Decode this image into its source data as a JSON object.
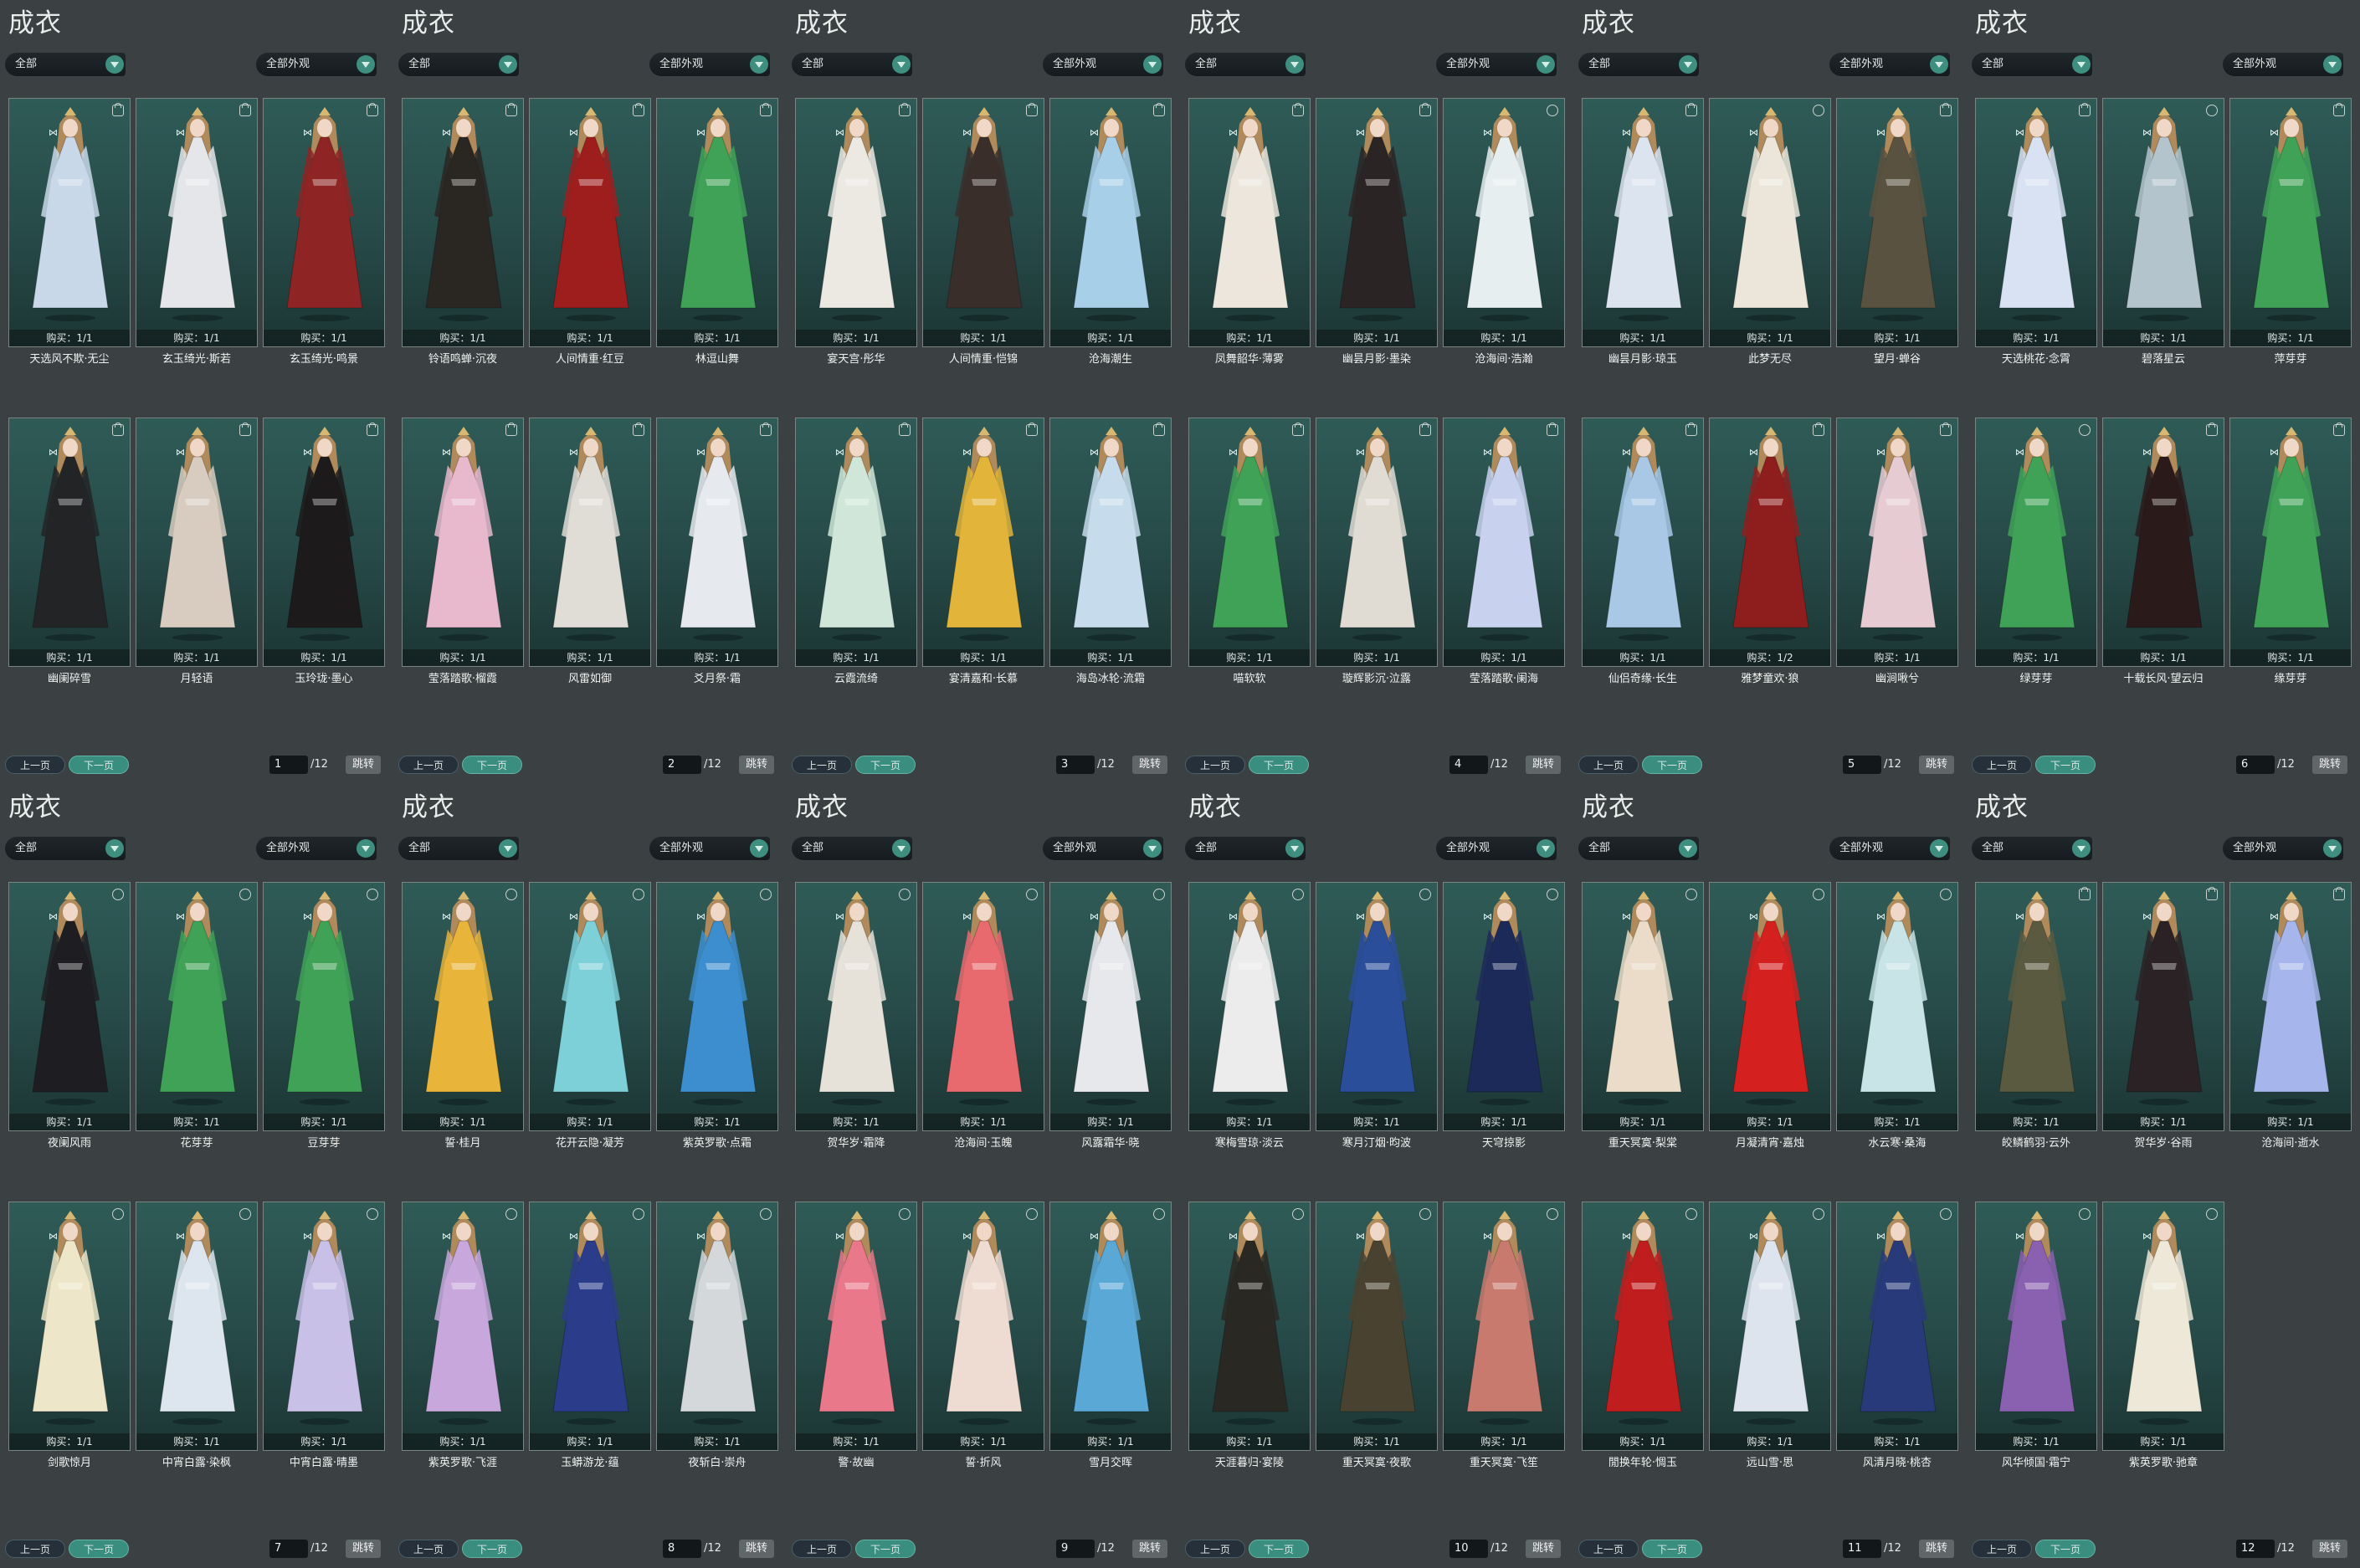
{
  "common": {
    "title": "成衣",
    "filter_left": "全部",
    "filter_right": "全部外观",
    "prev_label": "上一页",
    "next_label": "下一页",
    "total": "/12",
    "jump_label": "跳转"
  },
  "panels": [
    {
      "page": "1",
      "items": [
        {
          "name": "天选风不欺·无尘",
          "buy": "购买：1/1",
          "color": "#c8d8e8",
          "badge": "lock"
        },
        {
          "name": "玄玉绮光·斯若",
          "buy": "购买：1/1",
          "color": "#e4e6ea",
          "badge": "lock"
        },
        {
          "name": "玄玉绮光·鸣景",
          "buy": "购买：1/1",
          "color": "#8e2424",
          "badge": "lock"
        },
        {
          "name": "幽阑碎雪",
          "buy": "购买：1/1",
          "color": "#222426",
          "badge": "lock"
        },
        {
          "name": "月轻语",
          "buy": "购买：1/1",
          "color": "#d8ccc0",
          "badge": "lock"
        },
        {
          "name": "玉玲珑·墨心",
          "buy": "购买：1/1",
          "color": "#1c1a1a",
          "badge": "lock"
        }
      ]
    },
    {
      "page": "2",
      "items": [
        {
          "name": "铃语鸣蝉·沉夜",
          "buy": "购买：1/1",
          "color": "#2a2622",
          "badge": "lock"
        },
        {
          "name": "人间情重·红豆",
          "buy": "购买：1/1",
          "color": "#9e1e1e",
          "badge": "lock"
        },
        {
          "name": "林逗山舞",
          "buy": "购买：1/1",
          "color": "#3fa257",
          "badge": "lock"
        },
        {
          "name": "莹落踏歌·榴霞",
          "buy": "购买：1/1",
          "color": "#e8b8cc",
          "badge": "lock"
        },
        {
          "name": "风雷如御",
          "buy": "购买：1/1",
          "color": "#e0ddd6",
          "badge": "lock"
        },
        {
          "name": "爻月祭·霜",
          "buy": "购买：1/1",
          "color": "#e6eaee",
          "badge": "lock"
        }
      ]
    },
    {
      "page": "3",
      "items": [
        {
          "name": "宴天宫·彤华",
          "buy": "购买：1/1",
          "color": "#ece9e2",
          "badge": "lock"
        },
        {
          "name": "人间情重·恺锦",
          "buy": "购买：1/1",
          "color": "#3a2e2a",
          "badge": "lock"
        },
        {
          "name": "沧海潮生",
          "buy": "购买：1/1",
          "color": "#a8cfe8",
          "badge": "lock"
        },
        {
          "name": "云霞流绮",
          "buy": "购买：1/1",
          "color": "#cfe6d8",
          "badge": "lock"
        },
        {
          "name": "宴清嘉和·长慕",
          "buy": "购买：1/1",
          "color": "#e2b43a",
          "badge": "lock"
        },
        {
          "name": "海岛冰轮·流霜",
          "buy": "购买：1/1",
          "color": "#c6dcec",
          "badge": "lock"
        }
      ]
    },
    {
      "page": "4",
      "items": [
        {
          "name": "凤舞韶华·薄雾",
          "buy": "购买：1/1",
          "color": "#ece6dc",
          "badge": "lock"
        },
        {
          "name": "幽昙月影·墨染",
          "buy": "购买：1/1",
          "color": "#2a2424",
          "badge": "lock"
        },
        {
          "name": "沧海间·浩瀚",
          "buy": "购买：1/1",
          "color": "#e6eef0",
          "badge": "cycle"
        },
        {
          "name": "喵软软",
          "buy": "购买：1/1",
          "color": "#3fa257",
          "badge": "lock"
        },
        {
          "name": "璇辉影沉·泣露",
          "buy": "购买：1/1",
          "color": "#e0dcd4",
          "badge": "lock"
        },
        {
          "name": "莹落踏歌·阑海",
          "buy": "购买：1/1",
          "color": "#c8d2ee",
          "badge": "lock"
        }
      ]
    },
    {
      "page": "5",
      "items": [
        {
          "name": "幽昙月影·琼玉",
          "buy": "购买：1/1",
          "color": "#dce4f0",
          "badge": "lock"
        },
        {
          "name": "此梦无尽",
          "buy": "购买：1/1",
          "color": "#ece6da",
          "badge": "cycle"
        },
        {
          "name": "望月·蝉谷",
          "buy": "购买：1/1",
          "color": "#5a5240",
          "badge": "lock"
        },
        {
          "name": "仙侣奇缘·长生",
          "buy": "购买：1/1",
          "color": "#a8c8e6",
          "badge": "lock"
        },
        {
          "name": "雅梦童欢·狼",
          "buy": "购买：1/2",
          "color": "#8e1e1e",
          "badge": "lock"
        },
        {
          "name": "幽涧啾兮",
          "buy": "购买：1/1",
          "color": "#e6ccd2",
          "badge": "lock"
        }
      ]
    },
    {
      "page": "6",
      "items": [
        {
          "name": "天选桃花·念霄",
          "buy": "购买：1/1",
          "color": "#d8e2f2",
          "badge": "lock"
        },
        {
          "name": "碧落星云",
          "buy": "购买：1/1",
          "color": "#b4c4cc",
          "badge": "cycle"
        },
        {
          "name": "萍芽芽",
          "buy": "购买：1/1",
          "color": "#3fa257",
          "badge": "lock"
        },
        {
          "name": "绿芽芽",
          "buy": "购买：1/1",
          "color": "#3fa257",
          "badge": "cycle"
        },
        {
          "name": "十载长风·望云归",
          "buy": "购买：1/1",
          "color": "#2a1a1a",
          "badge": "lock"
        },
        {
          "name": "缘芽芽",
          "buy": "购买：1/1",
          "color": "#3fa257",
          "badge": "lock"
        }
      ]
    },
    {
      "page": "7",
      "items": [
        {
          "name": "夜阑风雨",
          "buy": "购买：1/1",
          "color": "#1e1e22",
          "badge": "cycle"
        },
        {
          "name": "花芽芽",
          "buy": "购买：1/1",
          "color": "#3fa257",
          "badge": "cycle"
        },
        {
          "name": "豆芽芽",
          "buy": "购买：1/1",
          "color": "#3fa257",
          "badge": "cycle"
        },
        {
          "name": "剑歌惊月",
          "buy": "购买：1/1",
          "color": "#eee6c8",
          "badge": "cycle"
        },
        {
          "name": "中宵白露·染枫",
          "buy": "购买：1/1",
          "color": "#dde6ee",
          "badge": "cycle"
        },
        {
          "name": "中宵白露·晴墨",
          "buy": "购买：1/1",
          "color": "#c8c0e6",
          "badge": "cycle"
        }
      ]
    },
    {
      "page": "8",
      "items": [
        {
          "name": "誓·桂月",
          "buy": "购买：1/1",
          "color": "#e8b43a",
          "badge": "cycle"
        },
        {
          "name": "花开云隐·凝芳",
          "buy": "购买：1/1",
          "color": "#7ed0d8",
          "badge": "cycle"
        },
        {
          "name": "紫英罗歌·点霜",
          "buy": "购买：1/1",
          "color": "#3c8ecf",
          "badge": "cycle"
        },
        {
          "name": "紫英罗歌·飞涯",
          "buy": "购买：1/1",
          "color": "#c8a8dc",
          "badge": "cycle"
        },
        {
          "name": "玉蟒游龙·蕴",
          "buy": "购买：1/1",
          "color": "#2a3c8a",
          "badge": "cycle"
        },
        {
          "name": "夜斩白·崇舟",
          "buy": "购买：1/1",
          "color": "#d4d8da",
          "badge": "cycle"
        }
      ]
    },
    {
      "page": "9",
      "items": [
        {
          "name": "贺华岁·霜降",
          "buy": "购买：1/1",
          "color": "#e6e2da",
          "badge": "cycle"
        },
        {
          "name": "沧海间·玉魄",
          "buy": "购买：1/1",
          "color": "#e86a6e",
          "badge": "cycle"
        },
        {
          "name": "风露霜华·晓",
          "buy": "购买：1/1",
          "color": "#e6e8ec",
          "badge": "cycle"
        },
        {
          "name": "警·故幽",
          "buy": "购买：1/1",
          "color": "#e8788a",
          "badge": "cycle"
        },
        {
          "name": "誓·折风",
          "buy": "购买：1/1",
          "color": "#eedcd2",
          "badge": "cycle"
        },
        {
          "name": "雪月交晖",
          "buy": "购买：1/1",
          "color": "#5aa8d6",
          "badge": "cycle"
        }
      ]
    },
    {
      "page": "10",
      "items": [
        {
          "name": "寒梅雪琼·淡云",
          "buy": "购买：1/1",
          "color": "#ececec",
          "badge": "cycle"
        },
        {
          "name": "寒月汀烟·昀波",
          "buy": "购买：1/1",
          "color": "#2a4e9a",
          "badge": "cycle"
        },
        {
          "name": "天穹掠影",
          "buy": "购买：1/1",
          "color": "#1c2a5a",
          "badge": "cycle"
        },
        {
          "name": "天涯暮归·宴陵",
          "buy": "购买：1/1",
          "color": "#2a2822",
          "badge": "cycle"
        },
        {
          "name": "重天冥寞·夜歌",
          "buy": "购买：1/1",
          "color": "#4a4230",
          "badge": "cycle"
        },
        {
          "name": "重天冥寞·飞笙",
          "buy": "购买：1/1",
          "color": "#c87a6e",
          "badge": "cycle"
        }
      ]
    },
    {
      "page": "11",
      "items": [
        {
          "name": "重天冥寞·梨棠",
          "buy": "购买：1/1",
          "color": "#eadcc8",
          "badge": "cycle"
        },
        {
          "name": "月凝清宵·嘉烛",
          "buy": "购买：1/1",
          "color": "#d4201e",
          "badge": "cycle"
        },
        {
          "name": "水云寒·桑海",
          "buy": "购买：1/1",
          "color": "#c8e4e6",
          "badge": "cycle"
        },
        {
          "name": "閒换年轮·惆玉",
          "buy": "购买：1/1",
          "color": "#c01e1e",
          "badge": "cycle"
        },
        {
          "name": "远山雪·思",
          "buy": "购买：1/1",
          "color": "#dde4ee",
          "badge": "cycle"
        },
        {
          "name": "风清月晓·桃杏",
          "buy": "购买：1/1",
          "color": "#283a7a",
          "badge": "cycle"
        }
      ]
    },
    {
      "page": "12",
      "items": [
        {
          "name": "皎鳞鹤羽·云外",
          "buy": "购买：1/1",
          "color": "#5a5a40",
          "badge": "lock"
        },
        {
          "name": "贺华岁·谷雨",
          "buy": "购买：1/1",
          "color": "#2a2224",
          "badge": "lock"
        },
        {
          "name": "沧海间·逝水",
          "buy": "购买：1/1",
          "color": "#a6b6ec",
          "badge": "lock"
        },
        {
          "name": "风华倾国·霜宁",
          "buy": "购买：1/1",
          "color": "#8a60b0",
          "badge": "cycle"
        },
        {
          "name": "紫英罗歌·驰章",
          "buy": "购买：1/1",
          "color": "#ede8d8",
          "badge": "cycle"
        }
      ]
    }
  ]
}
